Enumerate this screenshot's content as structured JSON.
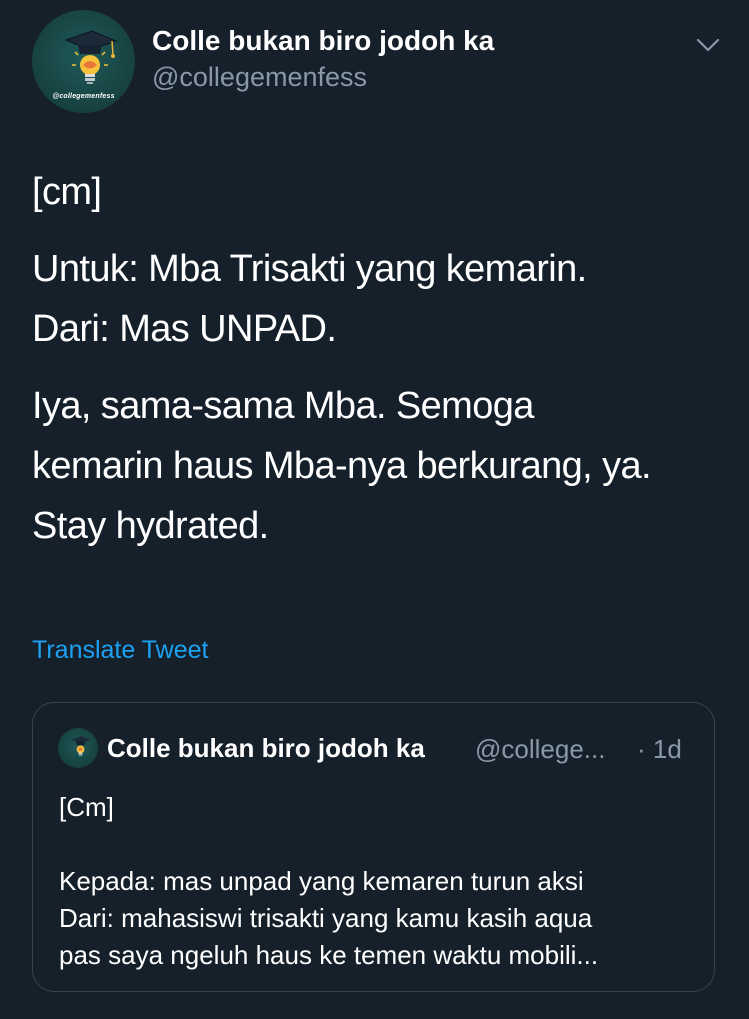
{
  "tweet": {
    "display_name": "Colle bukan biro jodoh ka",
    "handle": "@collegemenfess",
    "avatar_text": "@collegemenfess",
    "body": {
      "line1": "[cm]",
      "line2": "Untuk: Mba Trisakti yang kemarin.",
      "line3": "Dari: Mas UNPAD.",
      "line4": "Iya, sama-sama Mba. Semoga",
      "line5": "kemarin haus Mba-nya berkurang, ya.",
      "line6": "Stay hydrated."
    },
    "translate_label": "Translate Tweet",
    "menu_icon": "chevron-down-icon"
  },
  "quote": {
    "display_name": "Colle bukan biro jodoh ka",
    "handle": "@college...",
    "time": "· 1d",
    "body": {
      "line1": "[Cm]",
      "line2": "Kepada: mas unpad yang kemaren turun aksi",
      "line3": "Dari: mahasiswi trisakti yang kamu kasih aqua",
      "line4": "pas saya ngeluh haus ke temen waktu mobili..."
    }
  },
  "colors": {
    "background": "#15202b",
    "secondary_text": "#8899a6",
    "accent": "#1da1f2",
    "border": "#38444d"
  }
}
